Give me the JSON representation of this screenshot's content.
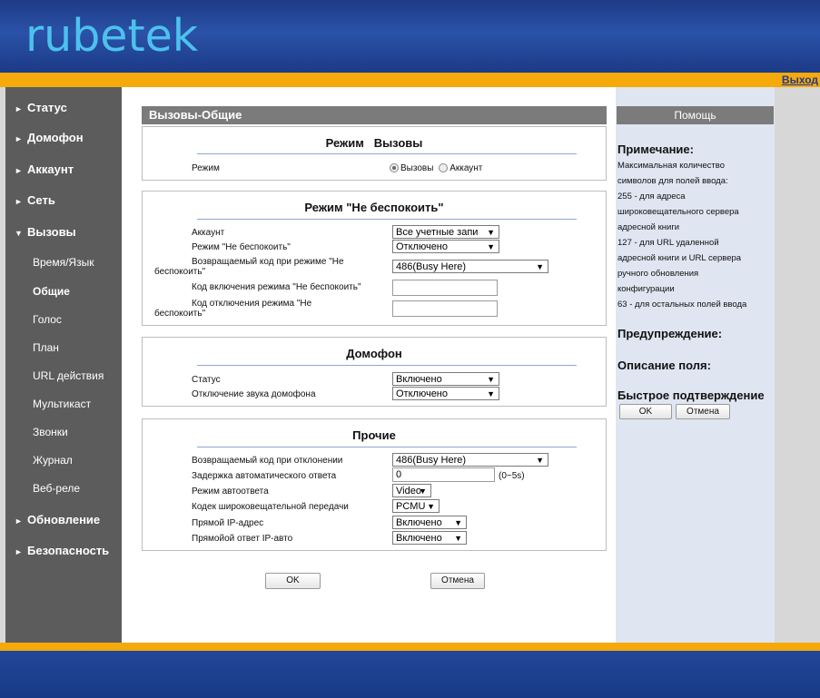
{
  "brand": {
    "logo_text": "rubetek",
    "logo_color": "#4dc1ee"
  },
  "top": {
    "logout_label": "Выход"
  },
  "sidebar": {
    "items": [
      {
        "label": "Статус",
        "arrow": "►"
      },
      {
        "label": "Домофон",
        "arrow": "►"
      },
      {
        "label": "Аккаунт",
        "arrow": "►"
      },
      {
        "label": "Сеть",
        "arrow": "►"
      },
      {
        "label": "Вызовы",
        "arrow": "▼"
      },
      {
        "label": "Обновление",
        "arrow": "►"
      },
      {
        "label": "Безопасность",
        "arrow": "►"
      }
    ],
    "sub_items": [
      "Время/Язык",
      "Общие",
      "Голос",
      "План",
      "URL действия",
      "Мультикаст",
      "Звонки",
      "Журнал",
      "Веб-реле"
    ]
  },
  "panel": {
    "title": "Вызовы-Общие"
  },
  "mode_section": {
    "title": "Режим   Вызовы",
    "label": "Режим",
    "options": [
      "Вызовы",
      "Аккаунт"
    ]
  },
  "dnd_section": {
    "title": "Режим \"Не беспокоить\"",
    "account_label": "Аккаунт",
    "account_value": "Все учетные запи",
    "dnd_label": "Режим \"Не беспокоить\"",
    "dnd_value": "Отключено",
    "return_code_label_1": "Возвращаемый код при режиме \"Не",
    "return_code_label_2": "беспокоить\"",
    "return_code_value": "486(Busy Here)",
    "on_code_label": "Код включения режима \"Не беспокоить\"",
    "off_code_label_1": "Код отключения режима \"Не",
    "off_code_label_2": "беспокоить\""
  },
  "intercom_section": {
    "title": "Домофон",
    "status_label": "Статус",
    "status_value": "Включено",
    "mute_label": "Отключение звука домофона",
    "mute_value": "Отключено"
  },
  "other_section": {
    "title": "Прочие",
    "reject_label": "Возвращаемый код при отклонении",
    "reject_value": "486(Busy Here)",
    "delay_label": "Задержка автоматического ответа",
    "delay_value": "0",
    "delay_hint": "(0~5s)",
    "auto_mode_label": "Режим автоответа",
    "auto_mode_value": "Video",
    "codec_label": "Кодек широковещательной передачи",
    "codec_value": "PCMU",
    "direct_ip_label": "Прямой IP-адрес",
    "direct_ip_value": "Включено",
    "direct_auto_label": "Прямойой ответ IP-авто",
    "direct_auto_value": "Включено"
  },
  "buttons": {
    "ok": "OK",
    "cancel": "Отмена"
  },
  "help": {
    "title": "Помощь",
    "note_heading": "Примечание:",
    "note_lines": [
      "Максимальная количество",
      "символов для полей ввода:",
      "255 - для адреса",
      "широковещательного сервера",
      "адресной книги",
      "127 - для URL удаленной",
      "адресной книги и URL сервера",
      "ручного обновления",
      "конфигурации",
      "63 - для остальных полей ввода"
    ],
    "warning_heading": "Предупреждение:",
    "field_heading": "Описание поля:",
    "quick_heading": "Быстрое подтверждение",
    "ok": "OK",
    "cancel": "Отмена"
  }
}
